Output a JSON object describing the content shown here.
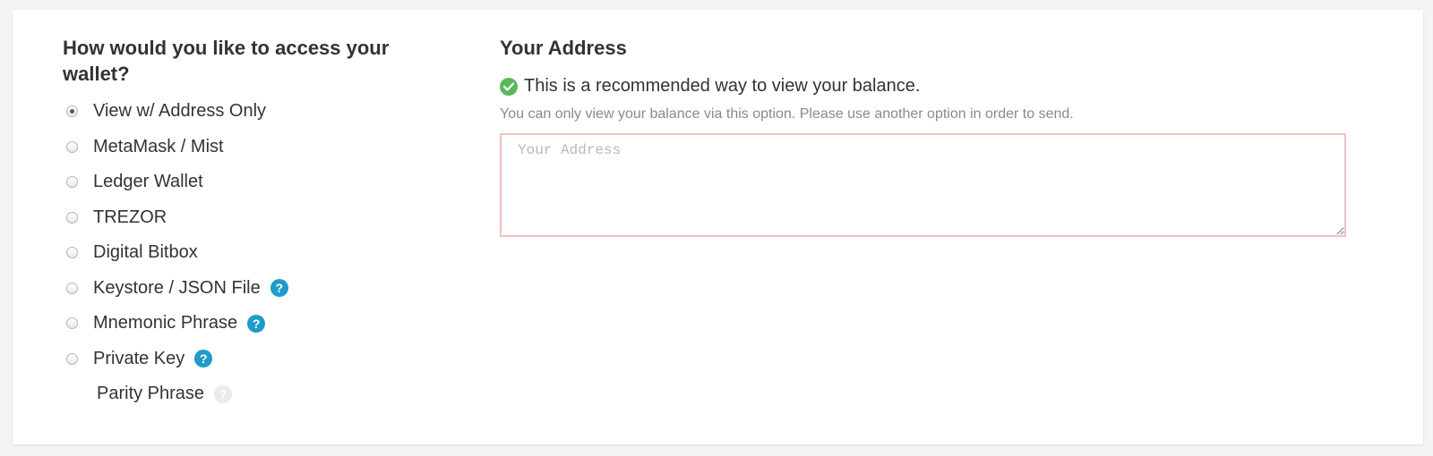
{
  "access": {
    "title": "How would you like to access your wallet?",
    "options": [
      {
        "label": "View w/ Address Only",
        "selected": true,
        "help": false
      },
      {
        "label": "MetaMask / Mist",
        "selected": false,
        "help": false
      },
      {
        "label": "Ledger Wallet",
        "selected": false,
        "help": false
      },
      {
        "label": "TREZOR",
        "selected": false,
        "help": false
      },
      {
        "label": "Digital Bitbox",
        "selected": false,
        "help": false
      },
      {
        "label": "Keystore / JSON File",
        "selected": false,
        "help": true
      },
      {
        "label": "Mnemonic Phrase",
        "selected": false,
        "help": true
      },
      {
        "label": "Private Key",
        "selected": false,
        "help": true
      },
      {
        "label": "Parity Phrase",
        "selected": false,
        "help": false,
        "disabled": true
      }
    ]
  },
  "address_panel": {
    "title": "Your Address",
    "recommendation": "This is a recommended way to view your balance.",
    "note": "You can only view your balance via this option. Please use another option in order to send.",
    "input_placeholder": "Your Address",
    "input_value": ""
  },
  "icons": {
    "help": "?",
    "check": "check-circle-icon"
  },
  "colors": {
    "help_icon": "#1f9cc9",
    "check_icon": "#5cb85c",
    "input_border": "#f2c0c0",
    "note_text": "#8a8a8a"
  }
}
